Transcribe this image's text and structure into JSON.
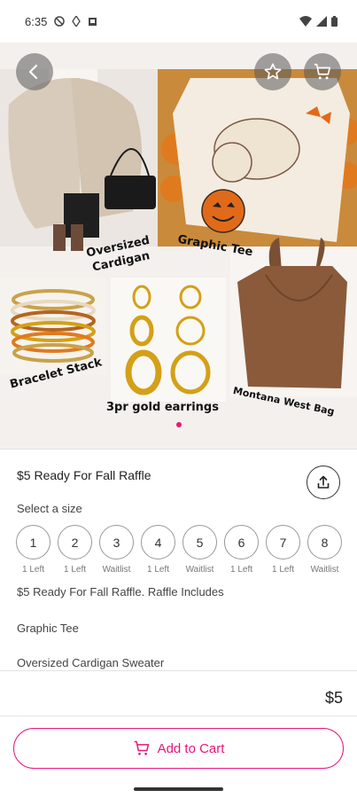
{
  "status_bar": {
    "time": "6:35"
  },
  "hero": {
    "labels": {
      "cardigan_line1": "Oversized",
      "cardigan_line2": "Cardigan",
      "tee": "Graphic Tee",
      "bracelet": "Bracelet Stack",
      "earrings": "3pr gold earrings",
      "bag": "Montana West Bag"
    },
    "icons": {
      "back": "arrow-left-icon",
      "favorite": "star-outline-icon",
      "cart": "cart-icon"
    },
    "carousel": {
      "current_page": 1,
      "total_pages": 1
    }
  },
  "product": {
    "title": "$5 Ready For Fall Raffle",
    "share_icon": "share-icon",
    "size_prompt": "Select a size",
    "sizes": [
      {
        "label": "1",
        "status": "1 Left"
      },
      {
        "label": "2",
        "status": "1 Left"
      },
      {
        "label": "3",
        "status": "Waitlist"
      },
      {
        "label": "4",
        "status": "1 Left"
      },
      {
        "label": "5",
        "status": "Waitlist"
      },
      {
        "label": "6",
        "status": "1 Left"
      },
      {
        "label": "7",
        "status": "1 Left"
      },
      {
        "label": "8",
        "status": "Waitlist"
      }
    ],
    "description_lines": [
      "$5 Ready For Fall Raffle. Raffle Includes",
      "Graphic Tee",
      "Oversized Cardigan Sweater"
    ]
  },
  "checkout": {
    "price": "$5",
    "add_to_cart_label": "Add to Cart"
  },
  "colors": {
    "accent": "#e8177a",
    "text": "#222222",
    "muted": "#777777"
  }
}
